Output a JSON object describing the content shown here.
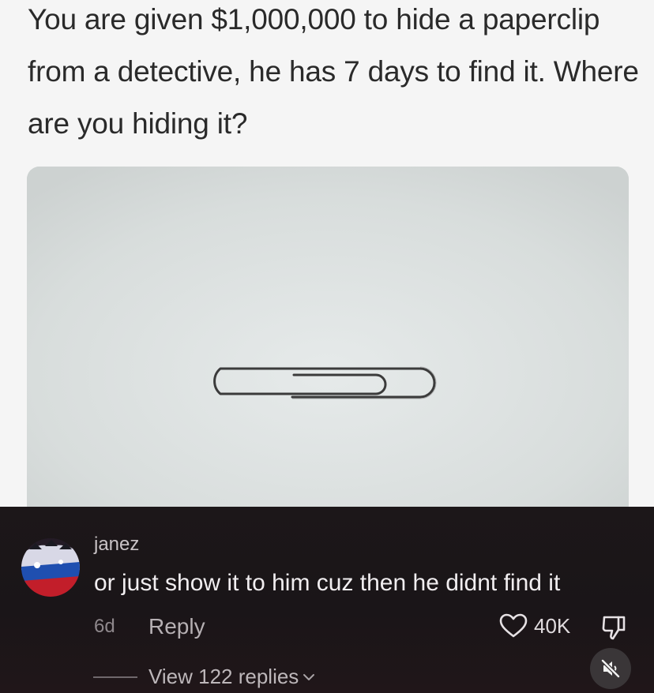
{
  "post": {
    "text": "You are given $1,000,000 to hide a paperclip from a detective, he has 7 days to find it. Where are you hiding it?",
    "image_icon": "paperclip-photo"
  },
  "comment": {
    "username": "janez",
    "text": "or just show it to him cuz then he didnt find it",
    "time": "6d",
    "reply_label": "Reply",
    "like_count": "40K",
    "view_replies_label": "View 122 replies"
  },
  "icons": {
    "like": "heart-icon",
    "dislike": "thumbs-down-icon",
    "mute": "muted-speaker-icon",
    "chevron": "chevron-down-icon"
  },
  "colors": {
    "post_background": "#f5f5f5",
    "comment_background": "#1a1619",
    "comment_text": "#f1eef0"
  }
}
